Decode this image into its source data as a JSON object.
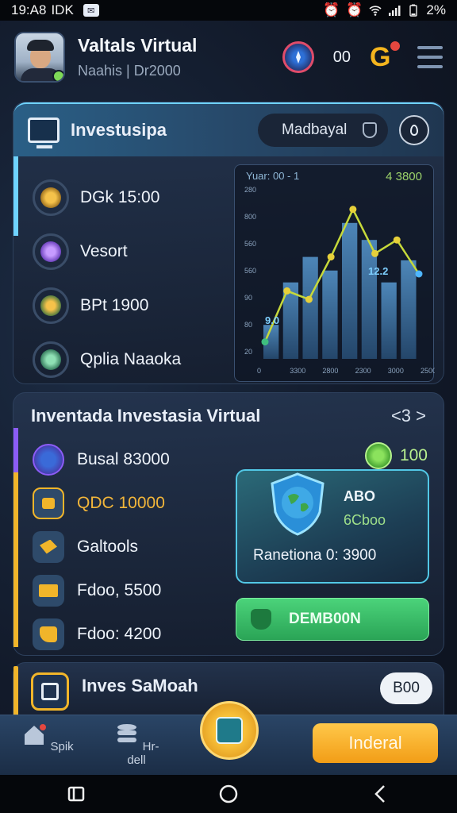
{
  "status_bar": {
    "time": "19:A8",
    "carrier": "IDK",
    "battery": "2%"
  },
  "header": {
    "name": "Valtals Virtual",
    "subtitle": "Naahis | Dr2000",
    "count": "00",
    "g_label": "G"
  },
  "invest": {
    "title": "Investusipa",
    "search_value": "Madbayal",
    "assets": [
      {
        "label": "DGk 15:00",
        "color": "#e2a33a"
      },
      {
        "label": "Vesort",
        "color": "#8b5cf6"
      },
      {
        "label": "BPt 1900",
        "color": "#e2a33a"
      },
      {
        "label": "Qplia Naaoka",
        "color": "#3fbf7f"
      }
    ]
  },
  "chart_data": {
    "type": "bar",
    "title": "Yuar: 00 - 1",
    "headline_value": "4 3800",
    "x_ticks": [
      "0",
      "3300",
      "2800",
      "2300",
      "3000",
      "2500"
    ],
    "y_ticks": [
      "280",
      "800",
      "560",
      "560",
      "90",
      "80",
      "20"
    ],
    "bars": [
      20,
      45,
      60,
      52,
      80,
      70,
      45,
      58
    ],
    "line": [
      10,
      40,
      35,
      60,
      88,
      62,
      70,
      50
    ],
    "annotations": [
      "9.0",
      "12.2"
    ],
    "ylim": [
      0,
      100
    ]
  },
  "virtual": {
    "title": "Inventada Investasia Virtual",
    "nav": "<3 >",
    "rows": [
      {
        "label": "Busal 83000",
        "icon_color": "#7a5cf0",
        "bar_color": "#8b5cf6"
      },
      {
        "label": "QDC 10000",
        "icon_color": "#e2a33a",
        "bar_color": "#f1b52a"
      },
      {
        "label": "Galtools",
        "icon_color": "#e2a33a",
        "bar_color": "#f1b52a"
      },
      {
        "label": "Fdoo, 5500",
        "icon_color": "#e2a33a",
        "bar_color": "#f1b52a"
      },
      {
        "label": "Fdoo: 4200",
        "icon_color": "#e2a33a",
        "bar_color": "#f1b52a"
      }
    ],
    "reward_value": "100",
    "prize_title": "ABO",
    "prize_value": "6Cboo",
    "prize_note": "Ranetiona 0: 3900",
    "claim_label": "DEMB00N"
  },
  "bottom_card": {
    "title": "Inves SaMoah",
    "pill": "B00"
  },
  "bottom_nav": {
    "home_label": "Spik",
    "mid_label": "Hr-dell",
    "primary_label": "Inderal"
  }
}
